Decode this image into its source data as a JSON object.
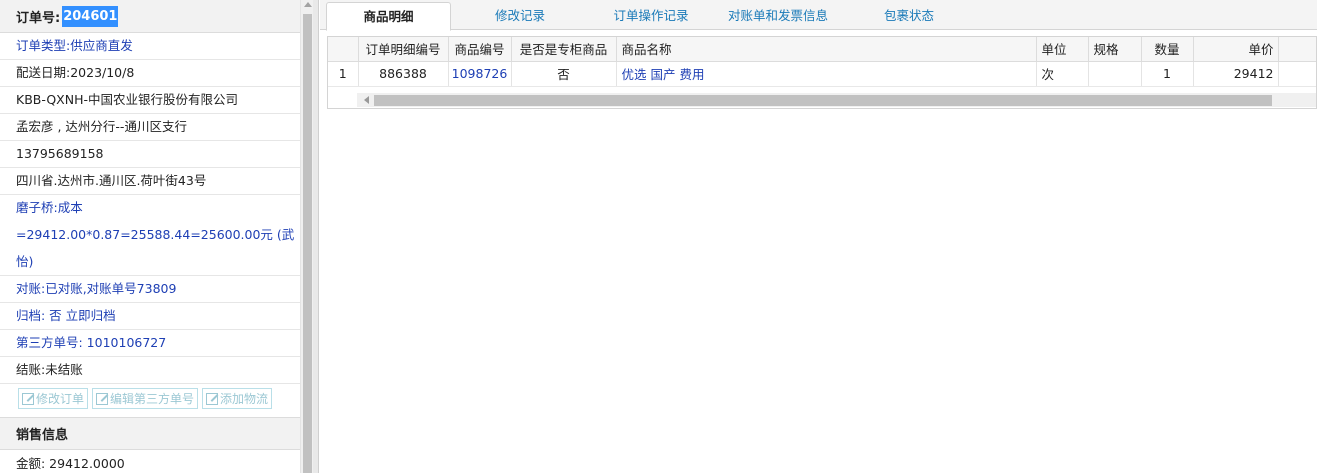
{
  "order": {
    "label": "订单号:",
    "number": "204601",
    "rows": [
      {
        "name": "order-type",
        "text": "订单类型:供应商直发",
        "blue": true
      },
      {
        "name": "delivery-date",
        "text": "配送日期:2023/10/8",
        "blue": false
      },
      {
        "name": "customer-company",
        "text": "KBB-QXNH-中国农业银行股份有限公司",
        "blue": false
      },
      {
        "name": "contact-branch",
        "text": "孟宏彦 , 达州分行--通川区支行",
        "blue": false
      },
      {
        "name": "contact-phone",
        "text": "13795689158",
        "blue": false
      },
      {
        "name": "delivery-address",
        "text": "四川省.达州市.通川区.荷叶街43号",
        "blue": false
      }
    ],
    "note_line1": "磨子桥:成本",
    "note_line2": "=29412.00*0.87=25588.44=25600.00元 (武",
    "note_line3": "怡)",
    "reconcile": "对账:已对账,对账单号73809",
    "archive": "归档: 否 立即归档",
    "third_party": "第三方单号: 1010106727",
    "settle": "结账:未结账"
  },
  "actions": {
    "edit_order": "修改订单",
    "edit_third_party": "编辑第三方单号",
    "add_logistics": "添加物流"
  },
  "sales": {
    "title": "销售信息",
    "amount": "金额: 29412.0000"
  },
  "tabs": [
    {
      "label": "商品明细",
      "active": true
    },
    {
      "label": "修改记录",
      "active": false
    },
    {
      "label": "订单操作记录",
      "active": false
    },
    {
      "label": "对账单和发票信息",
      "active": false
    },
    {
      "label": "包裹状态",
      "active": false
    }
  ],
  "grid": {
    "columns": [
      "",
      "订单明细编号",
      "商品编号",
      "是否是专柜商品",
      "商品名称",
      "单位",
      "规格",
      "数量",
      "单价"
    ],
    "rows": [
      [
        "1",
        "886388",
        "1098726",
        "否",
        "优选 国产 费用",
        "次",
        "",
        "1",
        "29412"
      ]
    ]
  }
}
